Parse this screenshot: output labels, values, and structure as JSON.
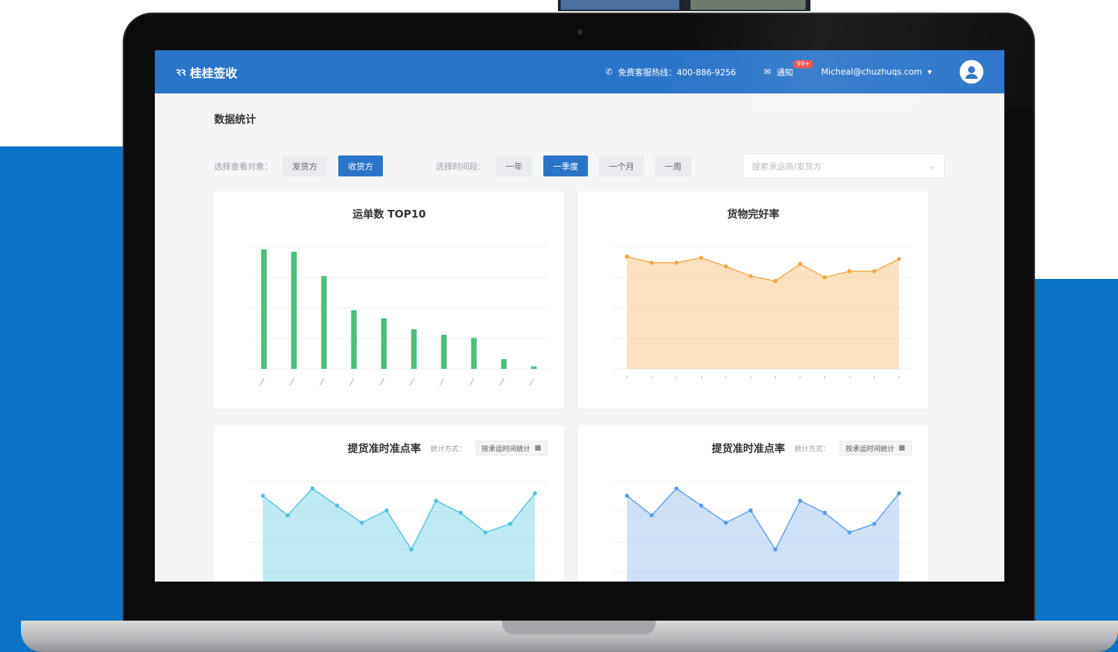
{
  "app": {
    "logo_text": "桂桂签收",
    "hotline": "免费客服热线：400-886-9256",
    "notify_label": "通知",
    "notify_badge": "99+",
    "user_email": "Micheal@chuzhuqs.com"
  },
  "page": {
    "title": "数据统计"
  },
  "filters": {
    "target_label": "选择查看对象：",
    "target_options": [
      "发货方",
      "收货方"
    ],
    "target_selected": "收货方",
    "time_label": "选择时间段：",
    "time_options": [
      "一年",
      "一季度",
      "一个月",
      "一周"
    ],
    "time_selected": "一季度",
    "search_placeholder": "搜索承运商/发货方"
  },
  "cards": {
    "top10_title": "运单数 TOP10",
    "goods_title": "货物完好率",
    "pickup_title": "提货准时准点率",
    "stat_label": "统计方式：",
    "stat_value": "按承运时间统计"
  },
  "colors": {
    "brand": "#2a74c9",
    "bar": "#4cbf7c",
    "area_orange": "#f8c98a",
    "area_cyan": "#8ad9ea",
    "area_blue": "#a8c8f0"
  },
  "chart_data": [
    {
      "type": "bar",
      "title": "运单数 TOP10",
      "values": [
        196,
        192,
        152,
        96,
        83,
        65,
        56,
        51,
        16,
        4
      ],
      "ylim": [
        0,
        200
      ]
    },
    {
      "type": "area",
      "title": "货物完好率",
      "values": [
        92,
        87,
        87,
        91,
        84,
        76,
        72,
        86,
        75,
        80,
        80,
        90
      ],
      "ylim": [
        0,
        100
      ]
    },
    {
      "type": "area",
      "title": "提货准时准点率",
      "values": [
        88,
        72,
        94,
        80,
        66,
        76,
        44,
        84,
        74,
        58,
        65,
        90
      ],
      "ylim": [
        0,
        100
      ]
    },
    {
      "type": "area",
      "title": "提货准时准点率",
      "values": [
        88,
        72,
        94,
        80,
        66,
        76,
        44,
        84,
        74,
        58,
        65,
        90
      ],
      "ylim": [
        0,
        100
      ]
    }
  ]
}
